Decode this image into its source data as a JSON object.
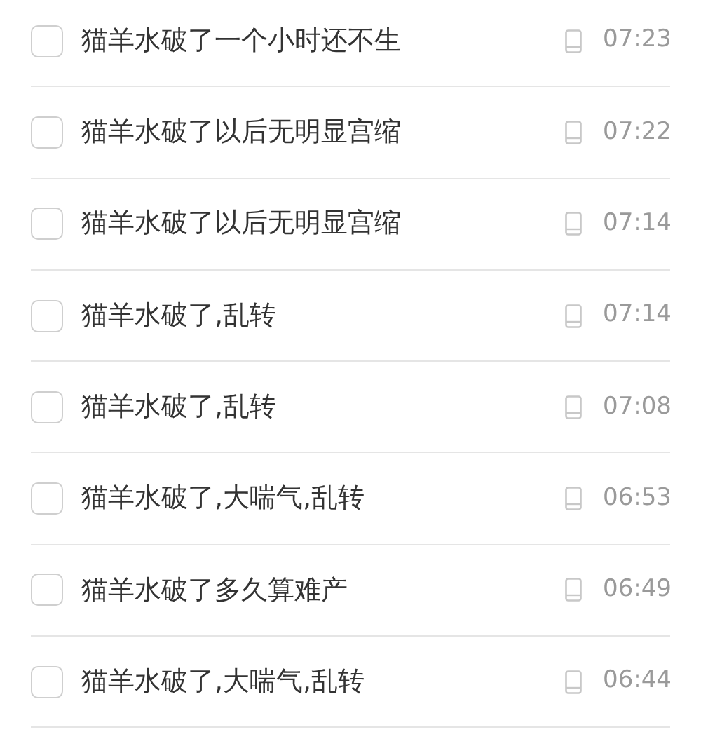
{
  "history": [
    {
      "query": "猫羊水破了一个小时还不生",
      "time": "07:23",
      "checked": false
    },
    {
      "query": "猫羊水破了以后无明显宫缩",
      "time": "07:22",
      "checked": false
    },
    {
      "query": "猫羊水破了以后无明显宫缩",
      "time": "07:14",
      "checked": false
    },
    {
      "query": "猫羊水破了,乱转",
      "time": "07:14",
      "checked": false
    },
    {
      "query": "猫羊水破了,乱转",
      "time": "07:08",
      "checked": false
    },
    {
      "query": "猫羊水破了,大喘气,乱转",
      "time": "06:53",
      "checked": false
    },
    {
      "query": "猫羊水破了多久算难产",
      "time": "06:49",
      "checked": false
    },
    {
      "query": "猫羊水破了,大喘气,乱转",
      "time": "06:44",
      "checked": false
    }
  ]
}
